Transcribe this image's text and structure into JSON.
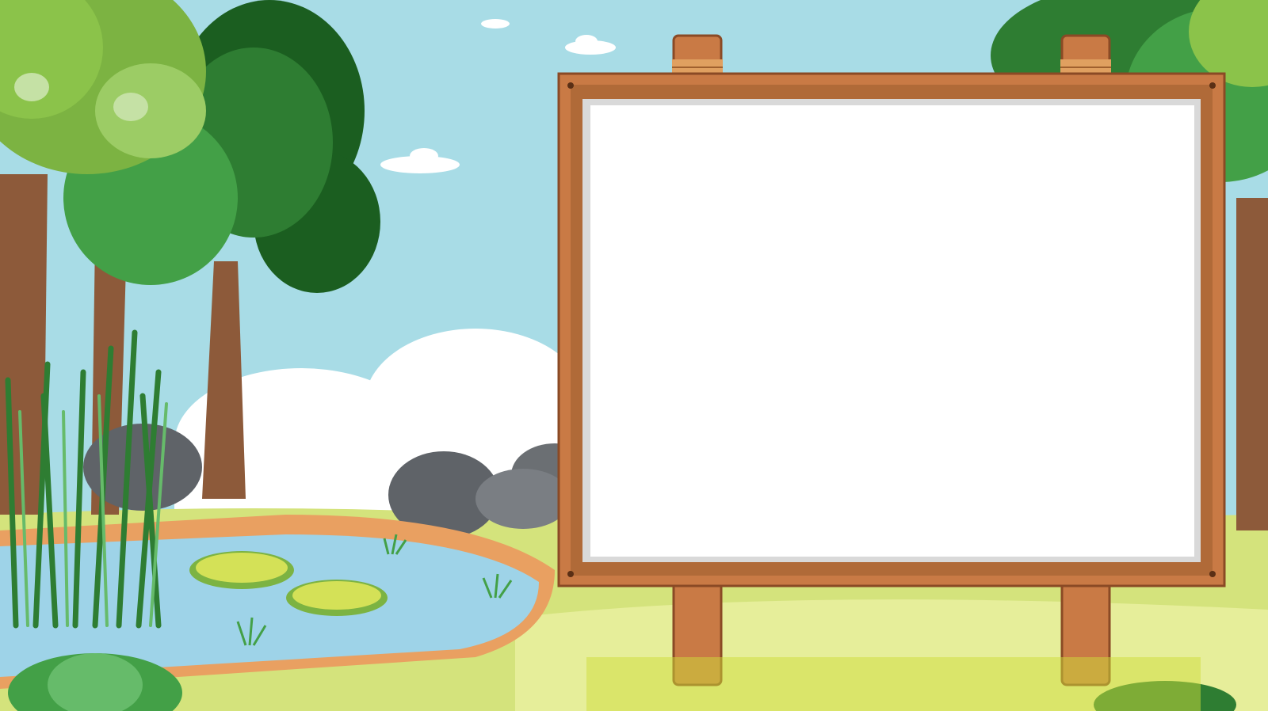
{
  "scene": {
    "description_free": true,
    "elements": {
      "sky": "sky",
      "clouds": [
        "cloud",
        "cloud",
        "cloud",
        "cloud",
        "cloud"
      ],
      "trees": [
        "tree",
        "tree",
        "tree",
        "tree"
      ],
      "pond": "pond",
      "lily_pads": [
        "lily-pad",
        "lily-pad"
      ],
      "reeds": "reeds",
      "rocks": [
        "rock",
        "rock",
        "rock",
        "rock"
      ],
      "sign": {
        "board": "blank-board",
        "posts": [
          "post-left",
          "post-right"
        ]
      },
      "bushes": [
        "bush",
        "bush"
      ]
    },
    "colors": {
      "sky": "#a8dce6",
      "cloud": "#ffffff",
      "grass": "#d4e37c",
      "grass_light": "#e6ee9a",
      "tree_dark": "#2e7d32",
      "tree_mid": "#43a047",
      "tree_light": "#8bc34a",
      "trunk": "#8d5a3a",
      "pond": "#9ed3e8",
      "pond_edge": "#e9a061",
      "wood": "#c97a45",
      "wood_dark": "#8a4a25",
      "board": "#ffffff",
      "rock": "#6b6f73"
    }
  }
}
